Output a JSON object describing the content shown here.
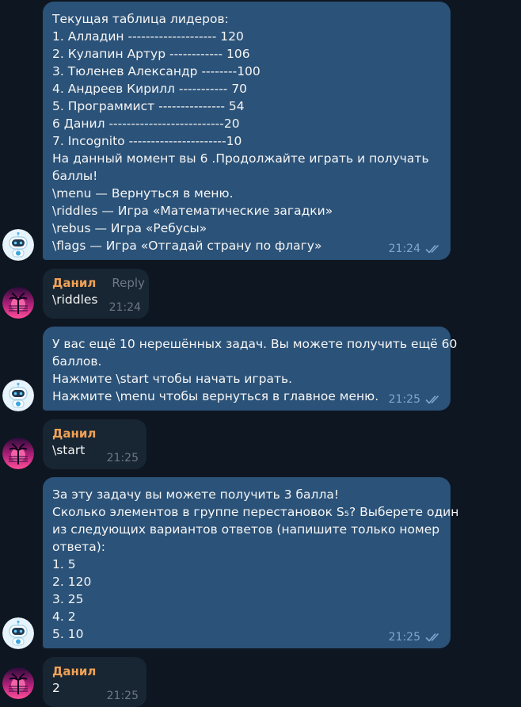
{
  "messages": [
    {
      "lines": [
        "Текущая таблица лидеров:",
        "1. Алладин -------------------- 120",
        "2. Кулапин Артур ------------ 106",
        "3. Тюленев Александр --------100",
        "4. Андреев Кирилл ----------- 70",
        "5. Программист --------------- 54",
        "6 Данил --------------------------20",
        "7. Incognito ----------------------10",
        "На данный момент вы 6 .Продолжайте играть и получать",
        "баллы!",
        "\\menu — Вернуться в меню.",
        "\\riddles — Игра «Математические загадки»",
        "\\rebus — Игра «Ребусы»",
        "\\flags — Игра «Отгадай страну по флагу»"
      ],
      "time": "21:24"
    },
    {
      "name": "Данил",
      "reply": "Reply",
      "text": "\\riddles",
      "time": "21:24"
    },
    {
      "lines": [
        "У вас ещё 10 нерешённых задач. Вы можете получить ещё 60",
        "баллов.",
        "Нажмите \\start чтобы начать играть.",
        "Нажмите \\menu чтобы вернуться в главное меню."
      ],
      "time": "21:25"
    },
    {
      "name": "Данил",
      "text": "\\start",
      "time": "21:25"
    },
    {
      "lines": [
        "За эту задачу вы можете получить 3 балла!",
        "Сколько элементов в группе перестановок S₅? Выберете один",
        "из следующих вариантов ответов (напишите только номер",
        "ответа):",
        "1. 5",
        "2. 120",
        "3. 25",
        "4. 2",
        "5. 10"
      ],
      "time": "21:25"
    },
    {
      "name": "Данил",
      "text": "2",
      "time": "21:25"
    }
  ],
  "colors": {
    "background": "#0e1621",
    "bot_bubble": "#2b5278",
    "user_bubble": "#182533",
    "username": "#f0a255",
    "read_check": "#7da8d3"
  },
  "icons": {
    "bot_avatar": "robot-icon",
    "user_avatar": "palm-sunset-icon",
    "read_status": "double-check-icon"
  }
}
